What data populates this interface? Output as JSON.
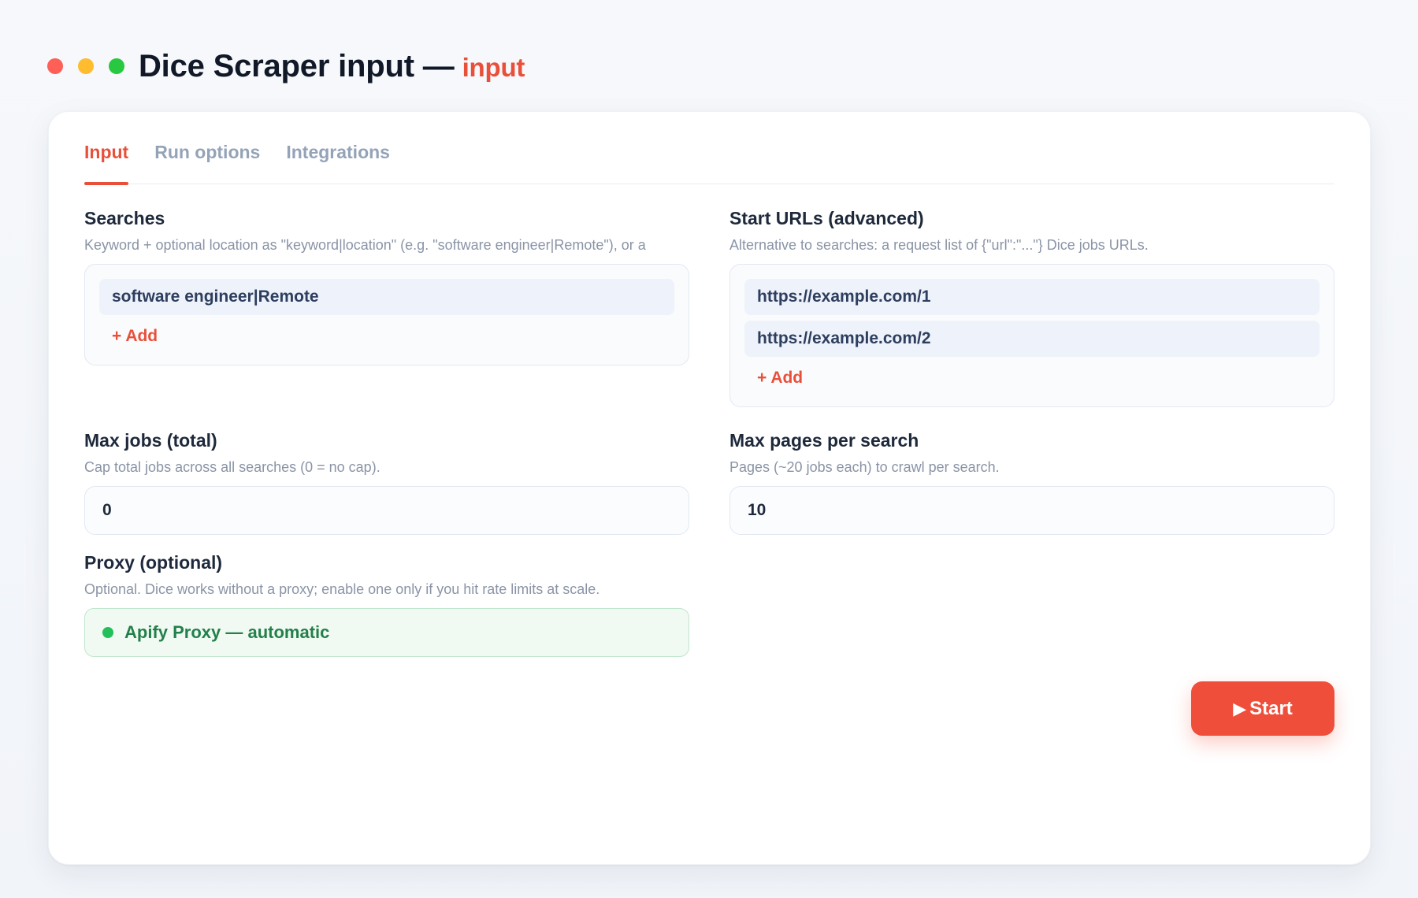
{
  "window": {
    "title": "Dice Scraper input —",
    "title_accent": "input"
  },
  "tabs": [
    {
      "label": "Input",
      "active": true
    },
    {
      "label": "Run options",
      "active": false
    },
    {
      "label": "Integrations",
      "active": false
    }
  ],
  "searches": {
    "label": "Searches",
    "help": "Keyword + optional location as \"keyword|location\" (e.g. \"software engineer|Remote\"), or a",
    "items": [
      "software engineer|Remote"
    ],
    "add_label": "+ Add"
  },
  "start_urls": {
    "label": "Start URLs (advanced)",
    "help": "Alternative to searches: a request list of {\"url\":\"...\"} Dice jobs URLs.",
    "items": [
      "https://example.com/1",
      "https://example.com/2"
    ],
    "add_label": "+ Add"
  },
  "max_jobs": {
    "label": "Max jobs (total)",
    "help": "Cap total jobs across all searches (0 = no cap).",
    "value": "0"
  },
  "max_pages": {
    "label": "Max pages per search",
    "help": "Pages (~20 jobs each) to crawl per search.",
    "value": "10"
  },
  "proxy": {
    "label": "Proxy (optional)",
    "help": "Optional. Dice works without a proxy; enable one only if you hit rate limits at scale.",
    "value": "Apify Proxy — automatic"
  },
  "start_button": {
    "icon": "▶",
    "label": "Start"
  },
  "colors": {
    "accent": "#e8503a",
    "button": "#ef4f3a",
    "proxy_green": "#23804a"
  }
}
